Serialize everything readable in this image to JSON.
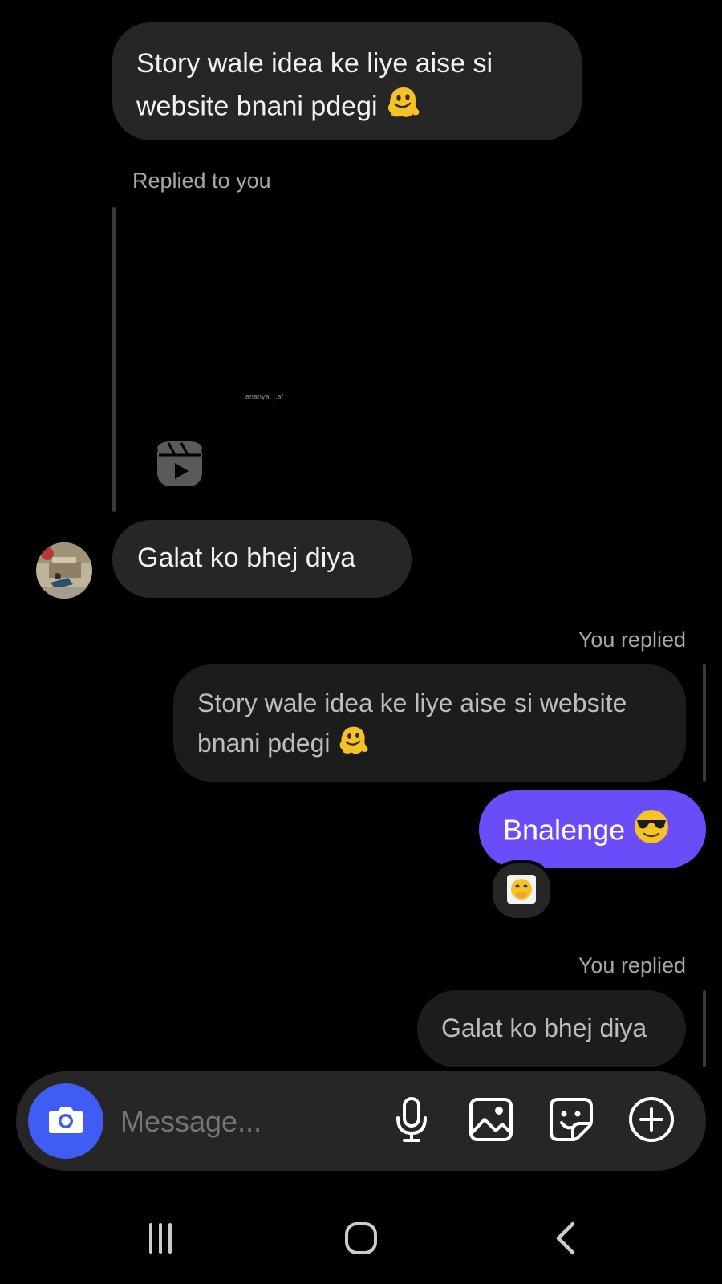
{
  "colors": {
    "background": "#000000",
    "incoming_bubble": "#262626",
    "quoted_bubble": "#1c1c1c",
    "outgoing_bubble": "#6a4cf8",
    "camera_button": "#3f5cf4"
  },
  "messages": {
    "first_incoming": {
      "line1": "Story wale idea ke liye aise si",
      "line2": "website bnani pdegi",
      "emoji": "melting-face-emoji"
    },
    "reel_reply": {
      "meta": "Replied to you",
      "reel_username": "ananya._.af",
      "reel_icon": "reels-icon"
    },
    "galat_incoming": {
      "text": "Galat ko bhej diya"
    },
    "you_replied_1": {
      "meta": "You replied",
      "quote_line1": "Story wale idea ke liye aise si website",
      "quote_line2": "bnani pdegi",
      "reply_text": "Bnalenge",
      "reply_emoji": "sunglasses-emoji",
      "reaction": "face-with-hand-over-mouth-emoji"
    },
    "you_replied_2": {
      "meta": "You replied",
      "quote_text": "Galat ko bhej diya"
    }
  },
  "composer": {
    "placeholder": "Message...",
    "camera_icon": "camera-icon",
    "mic_icon": "microphone-icon",
    "gallery_icon": "gallery-icon",
    "sticker_icon": "sticker-icon",
    "add_icon": "plus-circle-icon"
  },
  "navbar": {
    "recents_icon": "recents-icon",
    "home_icon": "home-icon",
    "back_icon": "back-icon"
  }
}
